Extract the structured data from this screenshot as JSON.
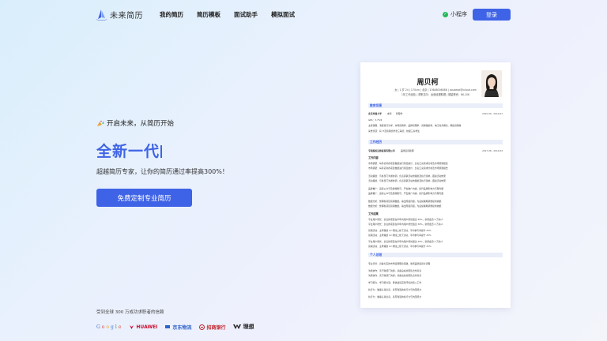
{
  "nav": {
    "logo_text": "未来简历",
    "links": [
      "我的简历",
      "简历模板",
      "面试助手",
      "模拟面试"
    ],
    "mini_program": "小程序",
    "login": "登录"
  },
  "hero": {
    "tag": "开启未来，从简历开始",
    "title": "全新一代",
    "subtitle": "超越简历专家，让你的简历通过率提高300%！",
    "cta": "免费定制专业简历"
  },
  "trust": {
    "text": "受到全球 300 万成功求职者的信赖",
    "brands": [
      "Google",
      "HUAWEI",
      "京东物流",
      "招商银行",
      "理想"
    ]
  },
  "resume": {
    "name": "周贝柯",
    "info_line1": "女 | 1 岁 24 | 170cm | 北京 | 13648006088 | zoubeiqi@icloud.com",
    "info_line2": "1年工作经验 | 求职意向：运营经理助理 | 期望薪资：8K-10K",
    "sections": {
      "edu": "教育背景",
      "work": "工作经历",
      "summary": "个人总结"
    },
    "edu": {
      "school": "北京外国大学",
      "degree": "本科",
      "major": "管理学",
      "period": "2015.09 - 2019.07",
      "gpa": "GPA：3.75/4",
      "courses": "主修课程：消费者行为学、市场营销学、品牌管理学、营销策划学、电子商务概论、网络营销等",
      "honors": "荣誉奖项：获 IT及营销奖学金三等奖，校级三好学生"
    },
    "work": {
      "company": "专职股权证券投资有限公司",
      "role": "品牌运营助理",
      "period": "2017.08 - 2019.03",
      "content_title": "工作内容",
      "items": [
        "市场调研：每月初对各项目数据进行月度统计，负责汇总需求分析及市场预测报告",
        "活动策划：与各部门沟通协调，负责营销活动的策划及执行落地，跟进活动效果",
        "品牌推广：运营公众号及微博账号，产出推广内容，提升品牌影响力与曝光量",
        "数据分析：整理各项目营销数据，输出周报月报，为后续策略调整提供依据"
      ],
      "results_title": "工作成果",
      "results": [
        "平台用户增长：负责的项目在半年内用户增长超过 30%，新增会员 2 万余人",
        "营销活动：主导策划 12 场线上线下活动，平均参与率提升 25%"
      ]
    },
    "summary": [
      "专业背景：具备扎实的市场营销理论基础，熟悉品牌运营全流程",
      "沟通协作：善于跨部门沟通，具备良好的团队合作意识",
      "学习能力：学习能力强，能快速适应新环境并投入工作",
      "执行力：做事认真负责，具有较强的执行力与抗压能力"
    ]
  },
  "colors": {
    "accent": "#3f63e6",
    "green": "#25b85a"
  }
}
